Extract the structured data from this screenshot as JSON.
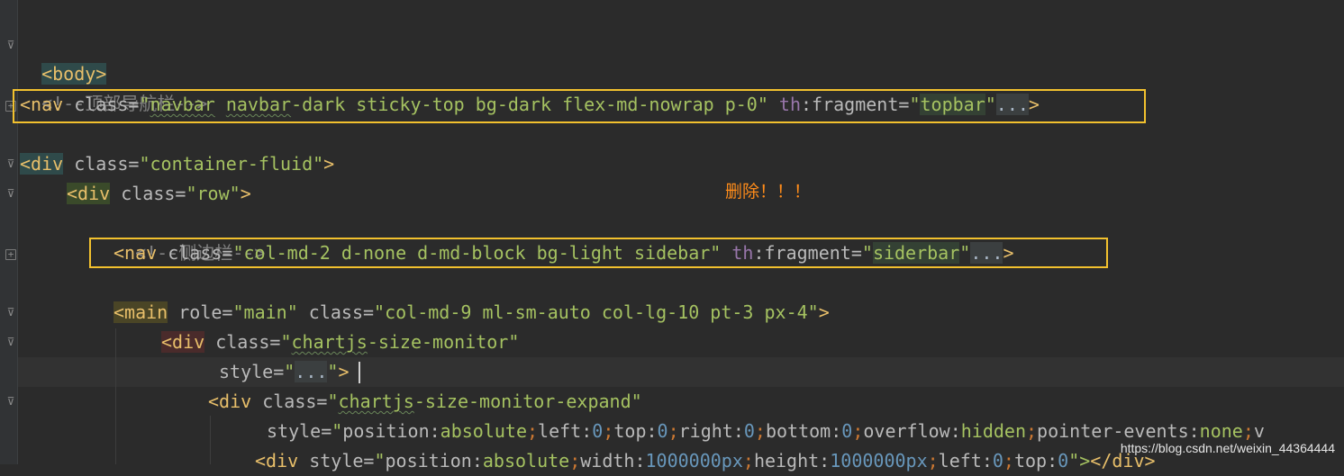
{
  "editor": {
    "lines": {
      "l1": {
        "tag": "<body>"
      },
      "l2": {
        "comment": "<!--顶部导航栏-->"
      },
      "l3": {
        "open": "<nav",
        "attr1": "class=",
        "val1_q1": "\"",
        "val1_w1": "navbar",
        "val1_sp": " ",
        "val1_w2": "navbar",
        "val1_rest": "-dark sticky-top bg-dark flex-md-nowrap p-0\"",
        "ns": "th",
        "attr2": ":fragment=",
        "q_open": "\"",
        "frag": "topbar",
        "q_close": "\"",
        "dots": "...",
        "close": ">"
      },
      "l4": {
        "open": "<div",
        "attr": "class=",
        "val": "\"container-fluid\"",
        "close": ">"
      },
      "l5": {
        "open": "<div",
        "attr": "class=",
        "val": "\"row\"",
        "close": ">"
      },
      "l6": {
        "comment": "<!--侧边栏-->"
      },
      "l7": {
        "open": "<nav",
        "attr1": "class=",
        "val1": "\"col-md-2 d-none d-md-block bg-light sidebar\"",
        "ns": "th",
        "attr2": ":fragment=",
        "q_open": "\"",
        "frag": "siderbar",
        "q_close": "\"",
        "dots": "...",
        "close": ">"
      },
      "l8": {
        "open": "<main",
        "attr1": "role=",
        "val1": "\"main\"",
        "attr2": "class=",
        "val2": "\"col-md-9 ml-sm-auto col-lg-10 pt-3 px-4\"",
        "close": ">"
      },
      "l9": {
        "open": "<div",
        "attr": "class=",
        "q": "\"",
        "word": "chartjs",
        "rest": "-size-monitor\""
      },
      "l10": {
        "attr": "style=",
        "q_open": "\"",
        "dots": "...",
        "q_close": "\"",
        "close": ">"
      },
      "l11": {
        "open": "<div",
        "attr": "class=",
        "q": "\"",
        "word": "chartjs",
        "rest": "-size-monitor-expand\""
      },
      "l12": {
        "attr": "style=",
        "q": "\"",
        "p1": "position:",
        "v1": "absolute",
        "s1": ";",
        "p2": "left:",
        "v2": "0",
        "s2": ";",
        "p3": "top:",
        "v3": "0",
        "s3": ";",
        "p4": "right:",
        "v4": "0",
        "s4": ";",
        "p5": "bottom:",
        "v5": "0",
        "s5": ";",
        "p6": "overflow:",
        "v6": "hidden",
        "s6": ";",
        "p7": "pointer-events:",
        "v7": "none",
        "s7": ";",
        "p8": "v"
      },
      "l13": {
        "open": "<div",
        "attr": "style=",
        "q": "\"",
        "p1": "position:",
        "v1": "absolute",
        "s1": ";",
        "p2": "width:",
        "v2": "1000000px",
        "s2": ";",
        "p3": "height:",
        "v3": "1000000px",
        "s3": ";",
        "p4": "left:",
        "v4": "0",
        "s4": ";",
        "p5": "top:",
        "v5": "0",
        "q_end": "\">",
        "closing": "</div>"
      }
    }
  },
  "annotation": {
    "text": "删除！！！",
    "color": "#ff8c1a"
  },
  "highlight_box_color": "#f2c12e",
  "watermark": "https://blog.csdn.net/weixin_44364444"
}
